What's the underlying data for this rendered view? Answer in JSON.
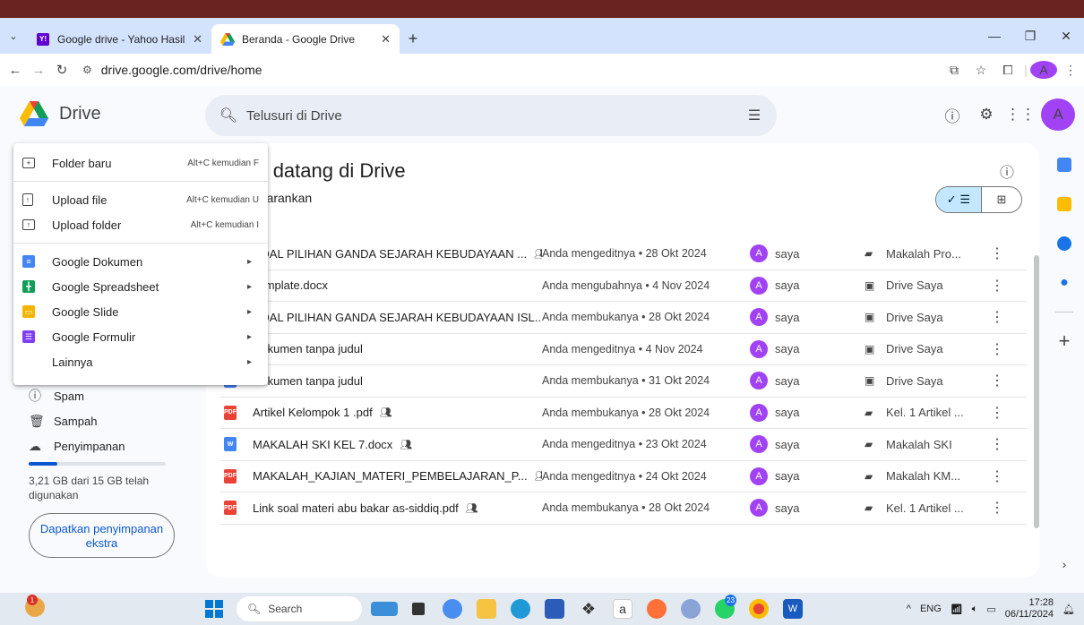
{
  "browser": {
    "tabs": [
      {
        "title": "Google drive - Yahoo Hasil Penc",
        "icon": "yahoo-icon",
        "color": "#6001d2"
      },
      {
        "title": "Beranda - Google Drive",
        "icon": "drive-icon",
        "active": true
      }
    ],
    "url": "drive.google.com/drive/home",
    "profile_initial": "A"
  },
  "header": {
    "app_name": "Drive",
    "search_placeholder": "Telusuri di Drive",
    "avatar_initial": "A"
  },
  "new_menu": {
    "items": [
      {
        "label": "Folder baru",
        "shortcut": "Alt+C kemudian F",
        "icon": "folder-add-icon"
      },
      {
        "label": "Upload file",
        "shortcut": "Alt+C kemudian U",
        "icon": "file-upload-icon"
      },
      {
        "label": "Upload folder",
        "shortcut": "Alt+C kemudian I",
        "icon": "folder-upload-icon"
      },
      {
        "label": "Google Dokumen",
        "arrow": "▸",
        "icon": "docs-icon",
        "color": "#4285f4"
      },
      {
        "label": "Google Spreadsheet",
        "arrow": "▸",
        "icon": "sheets-icon",
        "color": "#0f9d58"
      },
      {
        "label": "Google Slide",
        "arrow": "▸",
        "icon": "slides-icon",
        "color": "#f4b400"
      },
      {
        "label": "Google Formulir",
        "arrow": "▸",
        "icon": "forms-icon",
        "color": "#7e3ff2"
      },
      {
        "label": "Lainnya",
        "arrow": "▸"
      }
    ]
  },
  "sidebar": {
    "items": [
      {
        "label": "Spam",
        "icon": "spam-icon"
      },
      {
        "label": "Sampah",
        "icon": "trash-icon"
      },
      {
        "label": "Penyimpanan",
        "icon": "cloud-icon"
      }
    ],
    "storage_fraction": 0.21,
    "storage_text": "3,21 GB dari 15 GB telah digunakan",
    "storage_button": "Dapatkan penyimpanan ekstra"
  },
  "main": {
    "welcome_title": "hat datang di Drive",
    "suggested_label": "g disarankan",
    "files": [
      {
        "name": "SOAL PILIHAN GANDA SEJARAH KEBUDAYAAN ...",
        "shared": true,
        "type": "doc",
        "activity": "Anda mengeditnya • 28 Okt 2024",
        "owner": "saya",
        "location": "Makalah Pro...",
        "loc_shared": true
      },
      {
        "name": "Template.docx",
        "shared": false,
        "type": "doc",
        "activity": "Anda mengubahnya • 4 Nov 2024",
        "owner": "saya",
        "location": "Drive Saya",
        "loc_shared": false
      },
      {
        "name": "SOAL PILIHAN GANDA SEJARAH KEBUDAYAAN ISL...",
        "shared": false,
        "type": "doc",
        "activity": "Anda membukanya • 28 Okt 2024",
        "owner": "saya",
        "location": "Drive Saya",
        "loc_shared": false
      },
      {
        "name": "Dokumen tanpa judul",
        "shared": false,
        "type": "doc",
        "activity": "Anda mengeditnya • 4 Nov 2024",
        "owner": "saya",
        "location": "Drive Saya",
        "loc_shared": false
      },
      {
        "name": "Dokumen tanpa judul",
        "shared": false,
        "type": "doc",
        "activity": "Anda membukanya • 31 Okt 2024",
        "owner": "saya",
        "location": "Drive Saya",
        "loc_shared": false
      },
      {
        "name": "Artikel Kelompok 1 .pdf",
        "shared": true,
        "type": "pdf",
        "activity": "Anda membukanya • 28 Okt 2024",
        "owner": "saya",
        "location": "Kel. 1 Artikel ...",
        "loc_shared": true
      },
      {
        "name": "MAKALAH SKI KEL 7.docx",
        "shared": true,
        "type": "word",
        "activity": "Anda mengeditnya • 23 Okt 2024",
        "owner": "saya",
        "location": "Makalah SKI",
        "loc_shared": true
      },
      {
        "name": "MAKALAH_KAJIAN_MATERI_PEMBELAJARAN_P...",
        "shared": true,
        "type": "pdf",
        "activity": "Anda mengeditnya • 24 Okt 2024",
        "owner": "saya",
        "location": "Makalah KM...",
        "loc_shared": true
      },
      {
        "name": "Link soal materi abu bakar as-siddiq.pdf",
        "shared": true,
        "type": "pdf",
        "activity": "Anda membukanya • 28 Okt 2024",
        "owner": "saya",
        "location": "Kel. 1 Artikel ...",
        "loc_shared": true
      }
    ]
  },
  "taskbar": {
    "search_label": "Search",
    "language": "ENG",
    "time": "17:28",
    "date": "06/11/2024",
    "chrome_badge": "23",
    "weather_badge": "1"
  }
}
